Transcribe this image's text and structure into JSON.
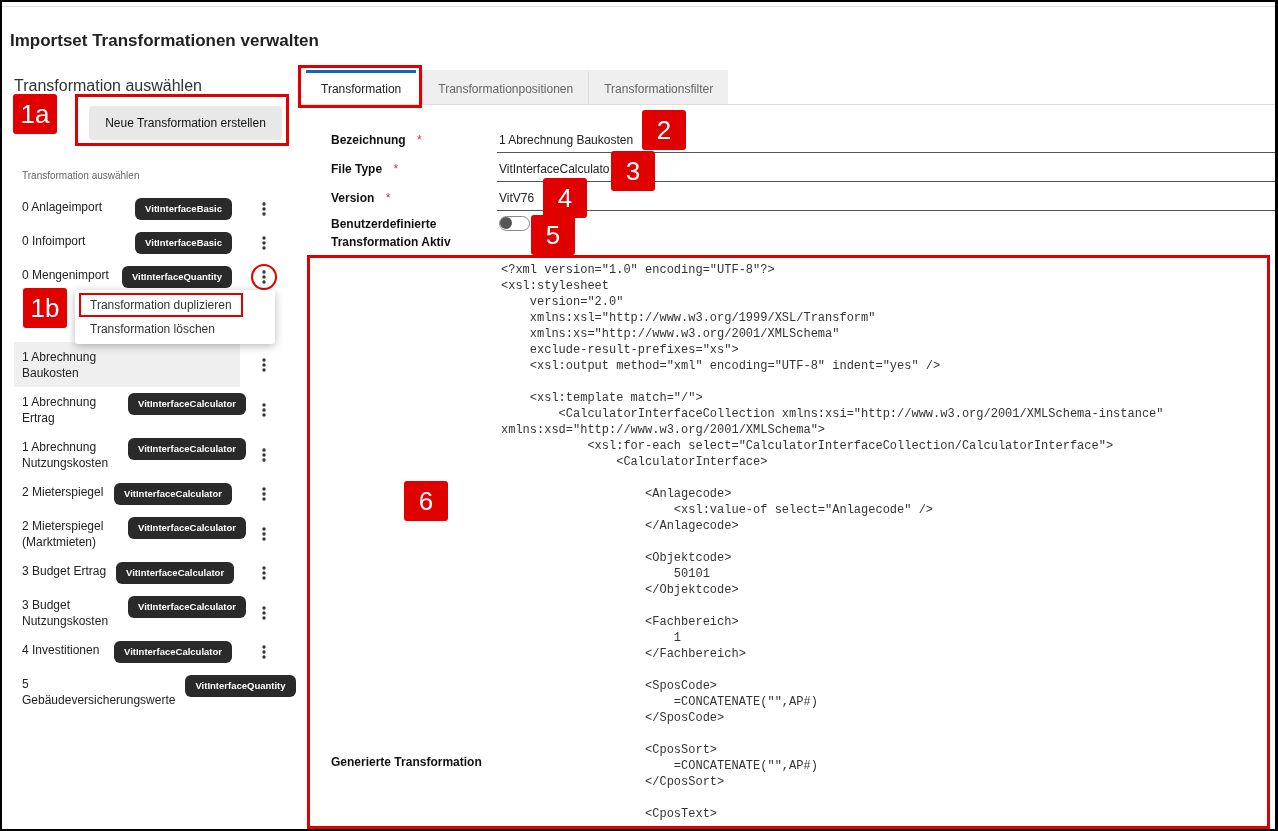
{
  "page_title": "Importset Transformationen verwalten",
  "left_panel": {
    "heading": "Transformation auswählen",
    "new_button": {
      "label": "Neue Transformation erstellen",
      "highlighted": true,
      "callout": "1a"
    },
    "list_label": "Transformation auswählen",
    "items": [
      {
        "name": "0 Anlageimport",
        "tag": "VitInterfaceBasic",
        "selected": false,
        "has_actions": true,
        "menu_open": false
      },
      {
        "name": "0 Infoimport",
        "tag": "VitInterfaceBasic",
        "selected": false,
        "has_actions": true,
        "menu_open": false
      },
      {
        "name": "0 Mengenimport",
        "tag": "VitInterfaceQuantity",
        "selected": false,
        "has_actions": true,
        "menu_open": true
      },
      {
        "name": "1 Abrechnung Baukosten",
        "selected": true,
        "has_actions": true,
        "menu_open": false
      },
      {
        "name": "1 Abrechnung Ertrag",
        "tag": "VitInterfaceCalculator",
        "selected": false,
        "has_actions": true,
        "menu_open": false
      },
      {
        "name": "1 Abrechnung Nutzungskosten",
        "tag": "VitInterfaceCalculator",
        "selected": false,
        "has_actions": true,
        "menu_open": false
      },
      {
        "name": "2 Mieterspiegel",
        "tag": "VitInterfaceCalculator",
        "selected": false,
        "has_actions": true,
        "menu_open": false
      },
      {
        "name": "2 Mieterspiegel (Marktmieten)",
        "tag": "VitInterfaceCalculator",
        "selected": false,
        "has_actions": true,
        "menu_open": false
      },
      {
        "name": "3 Budget Ertrag",
        "tag": "VitInterfaceCalculator",
        "selected": false,
        "has_actions": true,
        "menu_open": false
      },
      {
        "name": "3 Budget Nutzungskosten",
        "tag": "VitInterfaceCalculator",
        "selected": false,
        "has_actions": true,
        "menu_open": false
      },
      {
        "name": "4 Investitionen",
        "tag": "VitInterfaceCalculator",
        "selected": false,
        "has_actions": true,
        "menu_open": false
      },
      {
        "name": "5 Gebäudeversicherungswerte",
        "tag": "VitInterfaceQuantity",
        "selected": false,
        "has_actions": false,
        "menu_open": false
      }
    ],
    "context_menu": {
      "callout": "1b",
      "items": [
        {
          "label": "Transformation duplizieren",
          "highlighted": true
        },
        {
          "label": "Transformation löschen",
          "highlighted": false
        }
      ]
    }
  },
  "tabs": [
    {
      "label": "Transformation",
      "selected": true,
      "highlighted": true
    },
    {
      "label": "Transformationpositionen",
      "selected": false,
      "highlighted": false
    },
    {
      "label": "Transformationsfilter",
      "selected": false,
      "highlighted": false
    }
  ],
  "form": {
    "fields": [
      {
        "kind": "text",
        "label": "Bezeichnung",
        "required_mark": "*",
        "value": "1 Abrechnung Baukosten",
        "callout": "2"
      },
      {
        "kind": "text",
        "label": "File Type",
        "required_mark": "*",
        "value": "VitInterfaceCalculato",
        "callout": "3"
      },
      {
        "kind": "text",
        "label": "Version",
        "required_mark": "*",
        "value": "VitV76",
        "callout": "4"
      },
      {
        "kind": "toggle",
        "label": "Benutzerdefinierte Transformation Aktiv",
        "on": false,
        "callout": "5"
      },
      {
        "kind": "code",
        "label": "Generierte Transformation",
        "highlighted": true,
        "callout": "6",
        "value": "<?xml version=\"1.0\" encoding=\"UTF-8\"?>\n<xsl:stylesheet\n    version=\"2.0\"\n    xmlns:xsl=\"http://www.w3.org/1999/XSL/Transform\"\n    xmlns:xs=\"http://www.w3.org/2001/XMLSchema\"\n    exclude-result-prefixes=\"xs\">\n    <xsl:output method=\"xml\" encoding=\"UTF-8\" indent=\"yes\" />\n\n    <xsl:template match=\"/\">\n        <CalculatorInterfaceCollection xmlns:xsi=\"http://www.w3.org/2001/XMLSchema-instance\"\nxmlns:xsd=\"http://www.w3.org/2001/XMLSchema\">\n            <xsl:for-each select=\"CalculatorInterfaceCollection/CalculatorInterface\">\n                <CalculatorInterface>\n\n                    <Anlagecode>\n                        <xsl:value-of select=\"Anlagecode\" />\n                    </Anlagecode>\n\n                    <Objektcode>\n                        50101\n                    </Objektcode>\n\n                    <Fachbereich>\n                        1\n                    </Fachbereich>\n\n                    <SposCode>\n                        =CONCATENATE(\"\",AP#)\n                    </SposCode>\n\n                    <CposSort>\n                        =CONCATENATE(\"\",AP#)\n                    </CposSort>\n\n                    <CposText>"
      }
    ]
  }
}
